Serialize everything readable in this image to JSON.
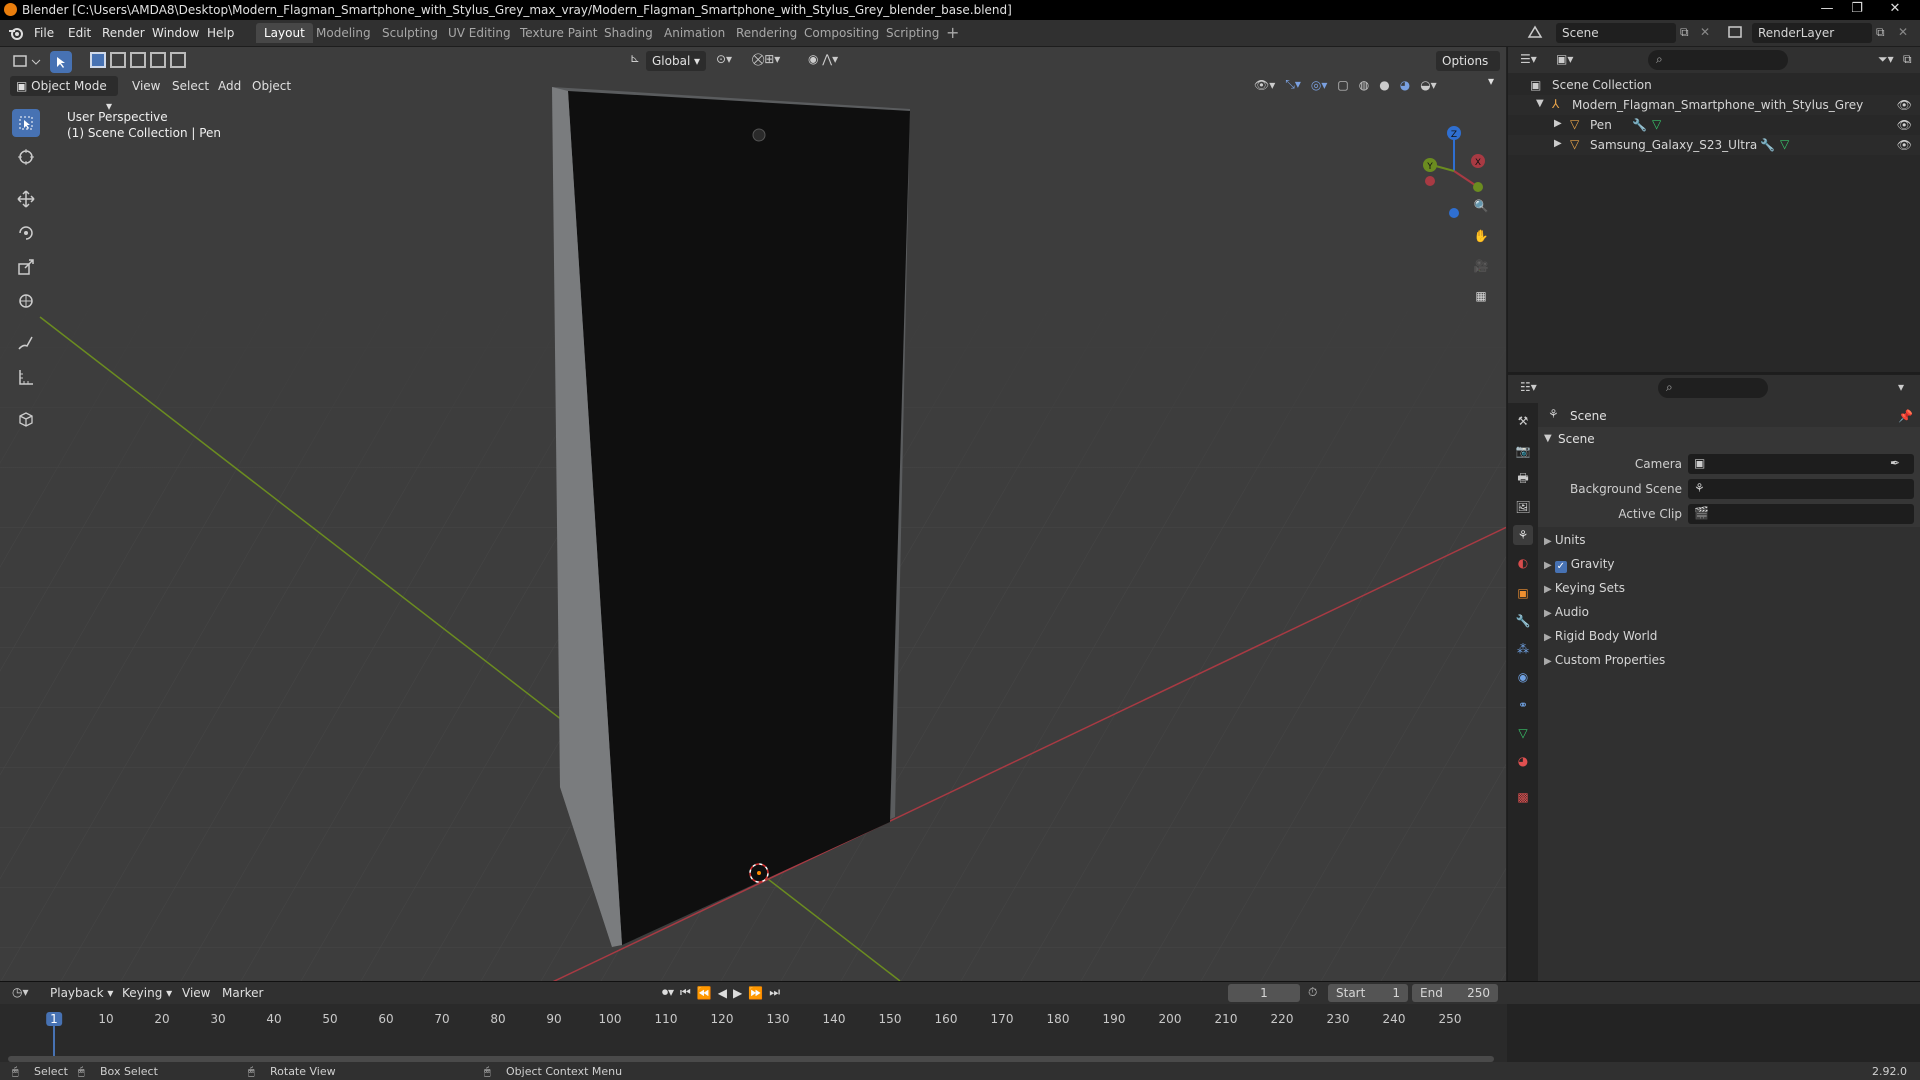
{
  "window": {
    "title": "Blender [C:\\Users\\AMDA8\\Desktop\\Modern_Flagman_Smartphone_with_Stylus_Grey_max_vray/Modern_Flagman_Smartphone_with_Stylus_Grey_blender_base.blend]",
    "controls": [
      "—",
      "❐",
      "✕"
    ]
  },
  "menu": [
    "File",
    "Edit",
    "Render",
    "Window",
    "Help"
  ],
  "workspaces": [
    "Layout",
    "Modeling",
    "Sculpting",
    "UV Editing",
    "Texture Paint",
    "Shading",
    "Animation",
    "Rendering",
    "Compositing",
    "Scripting"
  ],
  "active_workspace": "Layout",
  "add_workspace": "+",
  "scene_selector": {
    "value": "Scene"
  },
  "renderlayer_selector": {
    "value": "RenderLayer"
  },
  "viewport": {
    "mode": "Object Mode",
    "header_menus": [
      "View",
      "Select",
      "Add",
      "Object"
    ],
    "transform_orientation": "Global",
    "options_label": "Options",
    "perspective_label": "User Perspective",
    "collection_label": "(1) Scene Collection | Pen",
    "gizmo": {
      "x": "X",
      "y": "Y",
      "z": "Z"
    }
  },
  "outliner": {
    "root": "Scene Collection",
    "items": [
      {
        "label": "Modern_Flagman_Smartphone_with_Stylus_Grey",
        "depth": 1
      },
      {
        "label": "Pen",
        "depth": 2
      },
      {
        "label": "Samsung_Galaxy_S23_Ultra",
        "depth": 2
      }
    ]
  },
  "properties": {
    "context_title": "Scene",
    "panel_title": "Scene",
    "fields": [
      {
        "label": "Camera",
        "value": ""
      },
      {
        "label": "Background Scene",
        "value": ""
      },
      {
        "label": "Active Clip",
        "value": ""
      }
    ],
    "collapsed_panels": [
      "Units",
      "Gravity",
      "Keying Sets",
      "Audio",
      "Rigid Body World",
      "Custom Properties"
    ],
    "gravity_checked": true
  },
  "timeline": {
    "menus": [
      "Playback",
      "Keying",
      "View",
      "Marker"
    ],
    "current_frame": "1",
    "start_label": "Start",
    "start": "1",
    "end_label": "End",
    "end": "250",
    "ticks": [
      "1",
      "10",
      "20",
      "30",
      "40",
      "50",
      "60",
      "70",
      "80",
      "90",
      "100",
      "110",
      "120",
      "130",
      "140",
      "150",
      "160",
      "170",
      "180",
      "190",
      "200",
      "210",
      "220",
      "230",
      "240",
      "250"
    ]
  },
  "statusbar": {
    "select": "Select",
    "box_select": "Box Select",
    "rotate_view": "Rotate View",
    "context_menu": "Object Context Menu",
    "version": "2.92.0"
  },
  "colors": {
    "accent": "#4772b3",
    "x_axis": "#a83a43",
    "y_axis": "#6b8c20",
    "z_axis": "#2f6fd1"
  }
}
